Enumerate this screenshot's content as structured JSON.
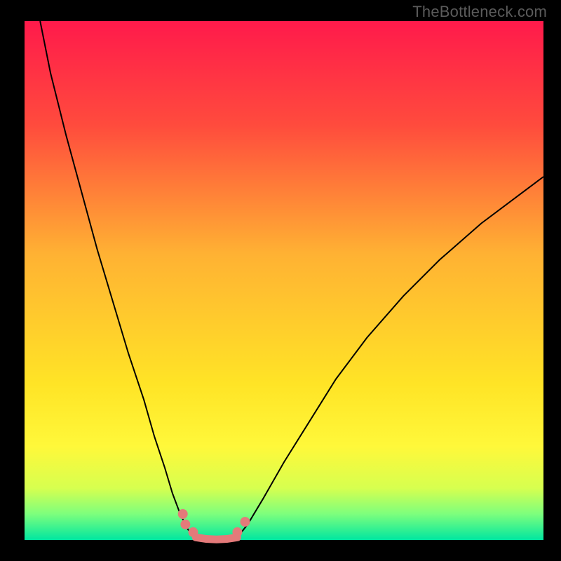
{
  "watermark": "TheBottleneck.com",
  "chart_data": {
    "type": "line",
    "title": "",
    "xlabel": "",
    "ylabel": "",
    "xlim": [
      0,
      100
    ],
    "ylim": [
      0,
      100
    ],
    "background_gradient_stops": [
      {
        "pos": 0.0,
        "color": "#ff1a4b"
      },
      {
        "pos": 0.2,
        "color": "#ff4b3d"
      },
      {
        "pos": 0.45,
        "color": "#ffb233"
      },
      {
        "pos": 0.7,
        "color": "#ffe426"
      },
      {
        "pos": 0.82,
        "color": "#fff83a"
      },
      {
        "pos": 0.9,
        "color": "#d7ff4f"
      },
      {
        "pos": 0.95,
        "color": "#7dff7d"
      },
      {
        "pos": 1.0,
        "color": "#00e6a0"
      }
    ],
    "series": [
      {
        "name": "left-branch",
        "stroke": "#000000",
        "stroke_width": 2,
        "x": [
          3,
          5,
          8,
          11,
          14,
          17,
          20,
          23,
          25,
          27,
          28.5,
          30,
          31.5,
          33
        ],
        "y": [
          100,
          90,
          78,
          67,
          56,
          46,
          36,
          27,
          20,
          14,
          9,
          5,
          2,
          0.5
        ]
      },
      {
        "name": "right-branch",
        "stroke": "#000000",
        "stroke_width": 2,
        "x": [
          41,
          43,
          46,
          50,
          55,
          60,
          66,
          73,
          80,
          88,
          96,
          100
        ],
        "y": [
          0.5,
          3,
          8,
          15,
          23,
          31,
          39,
          47,
          54,
          61,
          67,
          70
        ]
      },
      {
        "name": "valley-floor",
        "stroke": "#e47a7a",
        "stroke_width": 11,
        "linecap": "round",
        "x": [
          33,
          35,
          37,
          39,
          41
        ],
        "y": [
          0.5,
          0.2,
          0.1,
          0.2,
          0.5
        ]
      }
    ],
    "markers": [
      {
        "x": 30.5,
        "y": 5.0,
        "r": 7,
        "fill": "#e47a7a"
      },
      {
        "x": 31.0,
        "y": 3.0,
        "r": 7,
        "fill": "#e47a7a"
      },
      {
        "x": 32.5,
        "y": 1.5,
        "r": 7,
        "fill": "#e47a7a"
      },
      {
        "x": 41.0,
        "y": 1.5,
        "r": 7,
        "fill": "#e47a7a"
      },
      {
        "x": 42.5,
        "y": 3.5,
        "r": 7,
        "fill": "#e47a7a"
      }
    ]
  }
}
